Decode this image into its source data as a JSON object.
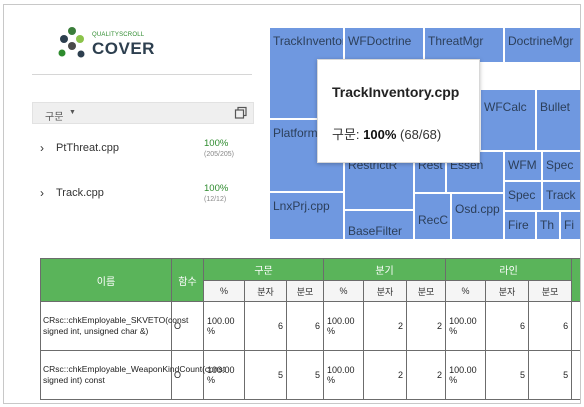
{
  "logo": {
    "small_text": "QUALITYSCROLL",
    "big_text": "COVER"
  },
  "sort": {
    "label": "구문",
    "caret": "▼"
  },
  "files": [
    {
      "name": "PtThreat.cpp",
      "percent": "100%",
      "count": "(205/205)"
    },
    {
      "name": "Track.cpp",
      "percent": "100%",
      "count": "(12/12)"
    }
  ],
  "treemap": {
    "labels": [
      "TrackInventory.cpp",
      "WFDoctrine",
      "ThreatMgr",
      "DoctrineMgr",
      "Platform",
      "WFCalc",
      "Bullet",
      "RestrictR",
      "Rest",
      "Essen",
      "WFM",
      "Spec",
      "LnxPrj.cpp",
      "BaseFilter",
      "RecC",
      "Osd.cpp",
      "Spec",
      "Track",
      "Fire",
      "Th",
      "Fi"
    ],
    "tooltip": {
      "title": "TrackInventory.cpp",
      "label": "구문:",
      "percent": "100%",
      "count": "(68/68)"
    }
  },
  "table": {
    "headers": {
      "name": "이름",
      "func": "함수",
      "group1": "구문",
      "group2": "분기",
      "group3": "라인"
    },
    "subheaders": [
      "%",
      "분자",
      "분모",
      "%",
      "분자",
      "분모",
      "%",
      "분자",
      "분모"
    ],
    "rows": [
      {
        "name": "CRsc::chkEmployable_SKVETO(const signed int, unsigned char &)",
        "func": "O",
        "cells": [
          "100.00 %",
          "6",
          "6",
          "100.00 %",
          "2",
          "2",
          "100.00 %",
          "6",
          "6"
        ]
      },
      {
        "name": "CRsc::chkEmployable_WeaponKindCount(const signed int) const",
        "func": "O",
        "cells": [
          "100.00 %",
          "5",
          "5",
          "100.00 %",
          "2",
          "2",
          "100.00 %",
          "5",
          "5"
        ]
      }
    ]
  },
  "colors": {
    "accent": "#5ab45a",
    "treemap_fill": "#6f98e0",
    "percent_green": "#2e8b2e"
  }
}
